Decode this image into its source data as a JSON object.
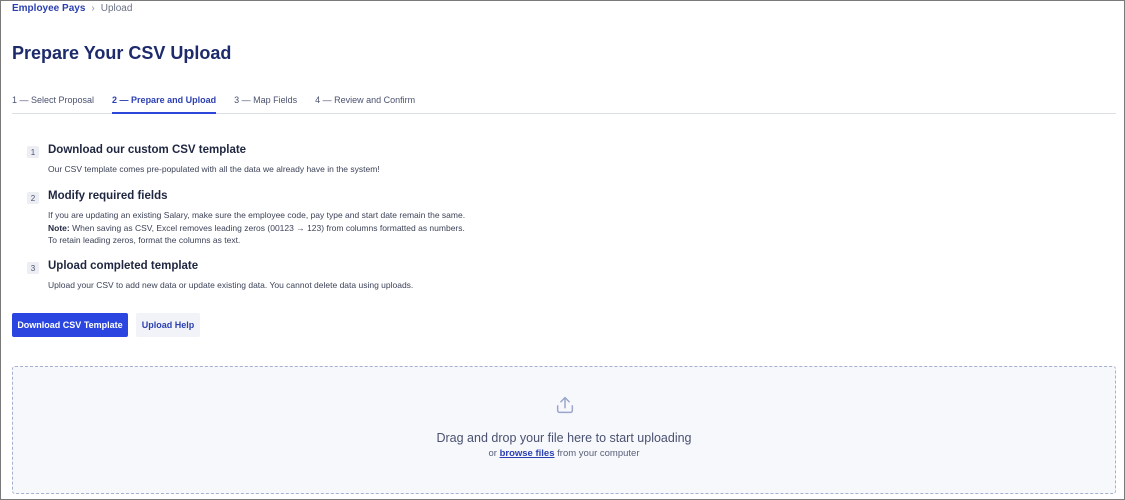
{
  "breadcrumb": {
    "parent": "Employee Pays",
    "separator": "›",
    "current": "Upload"
  },
  "page": {
    "title": "Prepare Your CSV Upload"
  },
  "tabs": [
    {
      "label": "1 — Select Proposal",
      "active": false
    },
    {
      "label": "2 — Prepare and Upload",
      "active": true
    },
    {
      "label": "3 — Map Fields",
      "active": false
    },
    {
      "label": "4 — Review and Confirm",
      "active": false
    }
  ],
  "steps": [
    {
      "number": "1",
      "title": "Download our custom CSV template",
      "description": "Our CSV template comes pre-populated with all the data we already have in the system!"
    },
    {
      "number": "2",
      "title": "Modify required fields",
      "description_before": "If you are updating an existing Salary, make sure the employee code, pay type and start date remain the same.",
      "note_label": "Note:",
      "description_after": "When saving as CSV, Excel removes leading zeros (00123 → 123) from columns formatted as numbers. To retain leading zeros, format the columns as text."
    },
    {
      "number": "3",
      "title": "Upload completed template",
      "description": "Upload your CSV to add new data or update existing data. You cannot delete data using uploads."
    }
  ],
  "buttons": {
    "download": "Download CSV Template",
    "help": "Upload Help"
  },
  "dropzone": {
    "icon": "upload-icon",
    "main_text": "Drag and drop your file here to start uploading",
    "prefix": "or",
    "link_text": "browse files",
    "suffix": "from your computer"
  },
  "colors": {
    "primary": "#2b46e0",
    "title": "#1d2a6b",
    "link": "#2b3fb0",
    "dropzone_bg": "#f6f8fc"
  }
}
